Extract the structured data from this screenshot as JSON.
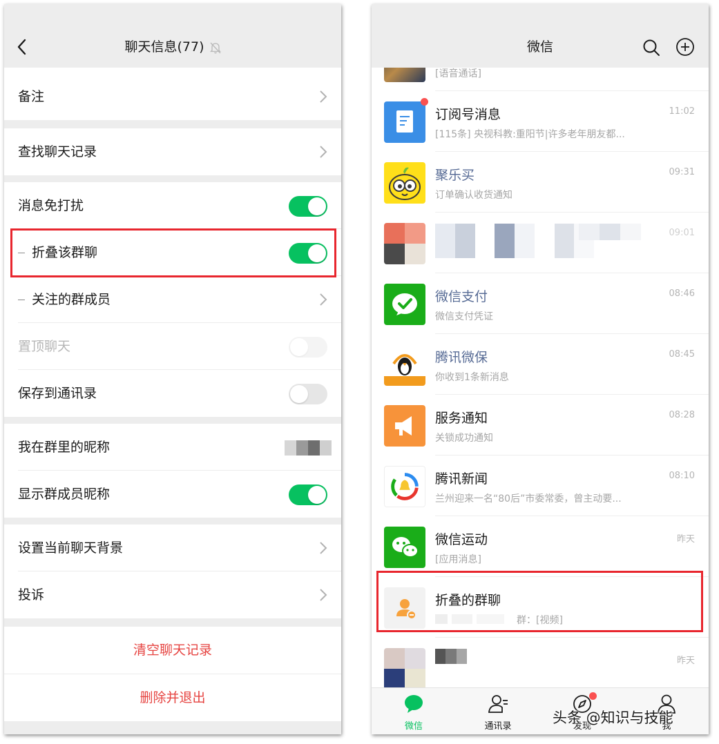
{
  "group_info": {
    "title": "聊天信息(77)",
    "rows": [
      {
        "label": "备注",
        "control": "chevron"
      },
      {
        "label": "查找聊天记录",
        "control": "chevron"
      },
      {
        "label": "消息免打扰",
        "control": "toggle",
        "state": "on"
      },
      {
        "label": "折叠该群聊",
        "control": "toggle",
        "state": "on",
        "highlighted": true
      },
      {
        "label": "关注的群成员",
        "control": "chevron"
      },
      {
        "label": "置顶聊天",
        "control": "toggle",
        "state": "off",
        "disabled": true
      },
      {
        "label": "保存到通讯录",
        "control": "toggle",
        "state": "off"
      },
      {
        "label": "我在群里的昵称",
        "control": "blurred-value"
      },
      {
        "label": "显示群成员昵称",
        "control": "toggle",
        "state": "on"
      },
      {
        "label": "设置当前聊天背景",
        "control": "chevron"
      },
      {
        "label": "投诉",
        "control": "chevron"
      }
    ],
    "actions": {
      "clear_history": "清空聊天记录",
      "delete_and_exit": "删除并退出"
    }
  },
  "chat_list": {
    "title": "微信",
    "partial_top_sub": "[语音通话]",
    "items": [
      {
        "name": "订阅号消息",
        "preview": "[115条] 央视科教:重阳节|许多老年朋友都...",
        "time": "11:02",
        "avatar": "subscription-icon",
        "unread_dot": true
      },
      {
        "name": "聚乐买",
        "preview": "订单确认收货通知",
        "time": "09:31",
        "avatar": "julemai-logo",
        "blue": true
      },
      {
        "name": "",
        "preview": "",
        "time": "09:01",
        "avatar": "blurred-avatar",
        "blurred": true
      },
      {
        "name": "微信支付",
        "preview": "微信支付凭证",
        "time": "08:46",
        "avatar": "wechat-pay-icon",
        "blue": true
      },
      {
        "name": "腾讯微保",
        "preview": "你收到1条新消息",
        "time": "08:45",
        "avatar": "weibao-logo",
        "blue": true
      },
      {
        "name": "服务通知",
        "preview": "关锁成功通知",
        "time": "08:28",
        "avatar": "megaphone-icon"
      },
      {
        "name": "腾讯新闻",
        "preview": "兰州迎来一名“80后”市委常委，曾主动要...",
        "time": "08:10",
        "avatar": "tencent-news-logo"
      },
      {
        "name": "微信运动",
        "preview": "[应用消息]",
        "time": "昨天",
        "avatar": "wechat-sport-icon"
      },
      {
        "name": "折叠的群聊",
        "preview": "群：[视频]",
        "time": "",
        "avatar": "folded-group-icon",
        "highlighted": true
      },
      {
        "name": "",
        "preview": "",
        "time": "昨天",
        "avatar": "blurred-avatar",
        "blurred": true
      }
    ],
    "tabs": [
      {
        "label": "微信",
        "icon": "chat-bubble-icon",
        "active": true
      },
      {
        "label": "通讯录",
        "icon": "contacts-icon"
      },
      {
        "label": "发现",
        "icon": "compass-icon",
        "dot": true
      },
      {
        "label": "我",
        "icon": "person-icon"
      }
    ]
  },
  "watermark": "头条 @知识与技能",
  "colors": {
    "wechat_green": "#07c160",
    "highlight_red": "#e8262e",
    "danger_red": "#e64340",
    "link_blue": "#576b95"
  }
}
